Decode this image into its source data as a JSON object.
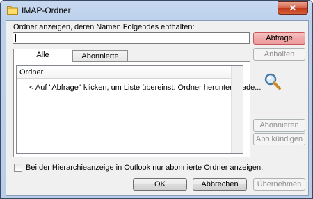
{
  "window": {
    "title": "IMAP-Ordner"
  },
  "search": {
    "label": "Ordner anzeigen, deren Namen Folgendes enthalten:",
    "value": ""
  },
  "buttons": {
    "query": "Abfrage",
    "stop": "Anhalten",
    "subscribe": "Abonnieren",
    "unsubscribe": "Abo kündigen",
    "ok": "OK",
    "cancel": "Abbrechen",
    "apply": "Übernehmen"
  },
  "tabs": [
    {
      "label": "Alle",
      "active": true
    },
    {
      "label": "Abonnierte",
      "active": false
    }
  ],
  "list": {
    "header": "Ordner",
    "rows": [
      "< Auf \"Abfrage\" klicken, um Liste übereinst. Ordner herunterzulade..."
    ]
  },
  "hierarchy_option": {
    "label": "Bei der Hierarchieanzeige in Outlook nur abonnierte Ordner anzeigen.",
    "checked": false
  },
  "colors": {
    "highlight": "#f0a8a8",
    "titlebar": "#bcd1ec",
    "close": "#c2381a"
  },
  "icons": [
    "folder-icon",
    "close-icon",
    "magnifier-icon"
  ]
}
